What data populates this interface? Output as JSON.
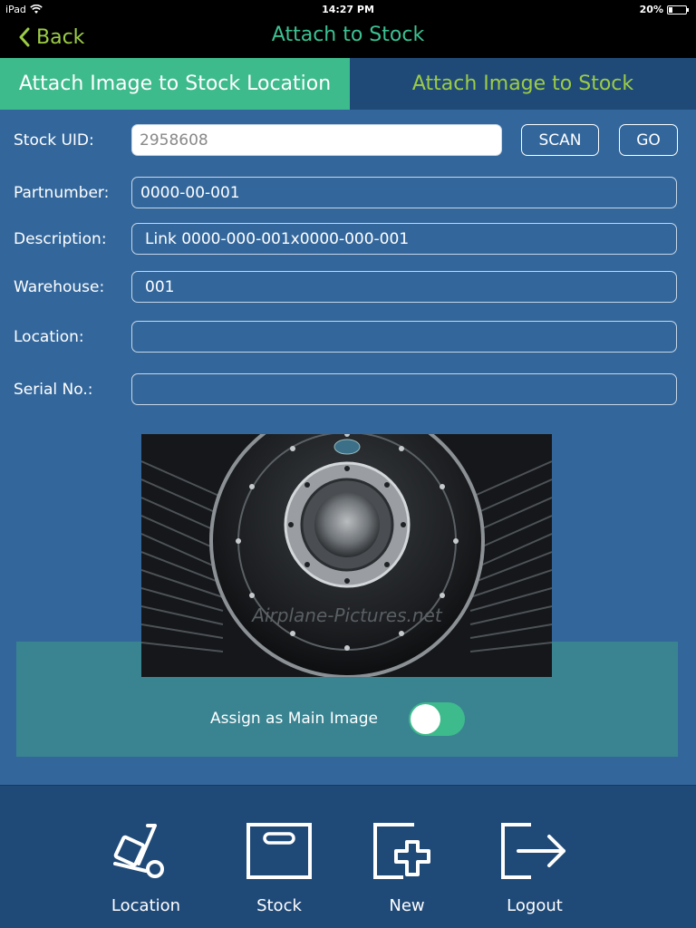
{
  "status_bar": {
    "device": "iPad",
    "time": "14:27 PM",
    "battery_text": "20%",
    "battery_level": 0.2
  },
  "nav": {
    "back_label": "Back",
    "title": "Attach to Stock"
  },
  "tabs": [
    {
      "label": "Attach Image to Stock Location",
      "active": true
    },
    {
      "label": "Attach Image to Stock",
      "active": false
    }
  ],
  "form": {
    "stock_uid": {
      "label": "Stock UID:",
      "value": "2958608"
    },
    "scan_label": "SCAN",
    "go_label": "GO",
    "partnumber": {
      "label": "Partnumber:",
      "value": "0000-00-001"
    },
    "description": {
      "label": "Description:",
      "value": "Link 0000-000-001x0000-000-001"
    },
    "warehouse": {
      "label": "Warehouse:",
      "value": "001"
    },
    "location": {
      "label": "Location:",
      "value": ""
    },
    "serial": {
      "label": "Serial No.:",
      "value": ""
    }
  },
  "image": {
    "watermark": "Airplane-Pictures.net"
  },
  "assign": {
    "label": "Assign as Main Image",
    "on": true
  },
  "toolbar": [
    {
      "label": "Location",
      "icon": "hand-truck-icon"
    },
    {
      "label": "Stock",
      "icon": "box-icon"
    },
    {
      "label": "New",
      "icon": "new-plus-icon"
    },
    {
      "label": "Logout",
      "icon": "logout-icon"
    }
  ],
  "colors": {
    "accent_green": "#3dbb8c",
    "lime": "#9ccc46",
    "panel_blue": "#33679c",
    "dark_blue": "#1f4a78"
  }
}
